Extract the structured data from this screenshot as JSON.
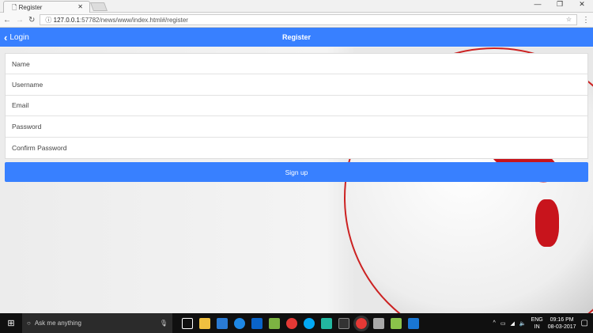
{
  "browser": {
    "tab_title": "Register",
    "url_host": "127.0.0.1",
    "url_rest": ":57782/news/www/index.html#/register"
  },
  "header": {
    "back_label": "Login",
    "title": "Register"
  },
  "form": {
    "fields": [
      {
        "placeholder": "Name"
      },
      {
        "placeholder": "Username"
      },
      {
        "placeholder": "Email"
      },
      {
        "placeholder": "Password"
      },
      {
        "placeholder": "Confirm Password"
      }
    ],
    "submit_label": "Sign up"
  },
  "taskbar": {
    "search_placeholder": "Ask me anything",
    "lang_1": "ENG",
    "lang_2": "IN",
    "time": "09:16 PM",
    "date": "08-03-2017"
  },
  "colors": {
    "accent": "#3880ff"
  }
}
